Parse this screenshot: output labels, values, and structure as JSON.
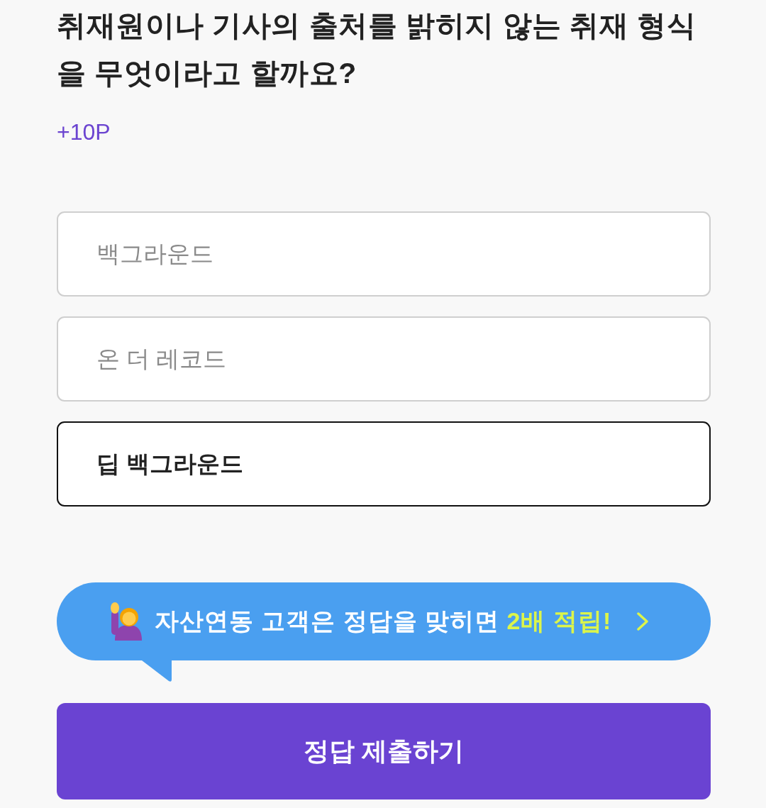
{
  "question": "취재원이나 기사의 출처를 밝히지 않는 취재 형식을 무엇이라고 할까요?",
  "reward": "+10P",
  "options": [
    {
      "label": "백그라운드",
      "selected": false
    },
    {
      "label": "온 더 레코드",
      "selected": false
    },
    {
      "label": "딥 백그라운드",
      "selected": true
    }
  ],
  "promo": {
    "text": "자산연동 고객은 정답을 맞히면 **2배 적립!**"
  },
  "submit_button": {
    "label": "정답 제출하기"
  }
}
